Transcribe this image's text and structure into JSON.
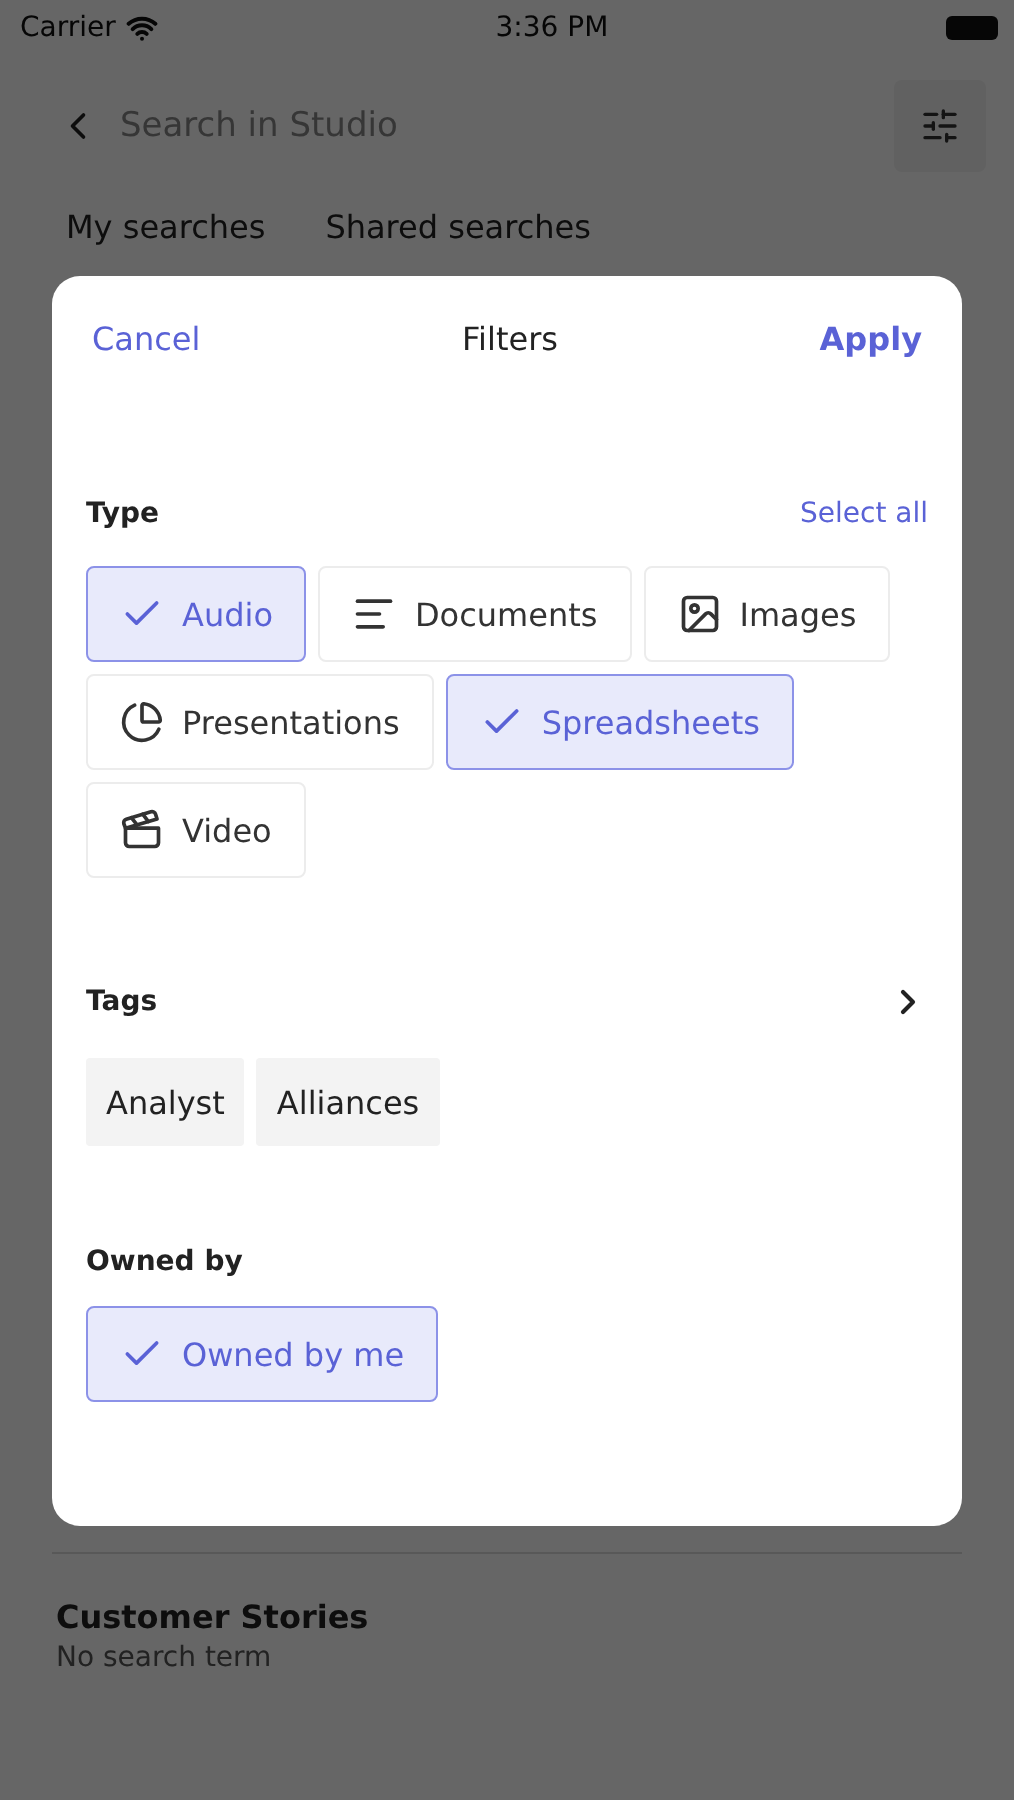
{
  "status_bar": {
    "carrier": "Carrier",
    "time": "3:36 PM"
  },
  "search": {
    "placeholder": "Search in Studio"
  },
  "tabs": [
    {
      "label": "My searches",
      "selected": false
    },
    {
      "label": "Shared searches",
      "selected": false
    }
  ],
  "saved_searches": [
    {
      "title": "Customer Stories",
      "subtitle": "No search term"
    }
  ],
  "dialog": {
    "cancel": "Cancel",
    "title": "Filters",
    "apply": "Apply",
    "type_section": {
      "heading": "Type",
      "select_all": "Select all",
      "options": [
        {
          "label": "Audio",
          "selected": true
        },
        {
          "label": "Documents",
          "kind": "documents",
          "selected": false
        },
        {
          "label": "Images",
          "kind": "images",
          "selected": false
        },
        {
          "label": "Presentations",
          "kind": "presentations",
          "selected": false
        },
        {
          "label": "Spreadsheets",
          "selected": true
        },
        {
          "label": "Video",
          "kind": "video",
          "selected": false
        }
      ]
    },
    "tags_section": {
      "heading": "Tags",
      "tags": [
        "Analyst",
        "Alliances"
      ]
    },
    "owner_section": {
      "heading": "Owned by",
      "options": [
        {
          "label": "Owned by me",
          "selected": true
        }
      ]
    }
  }
}
